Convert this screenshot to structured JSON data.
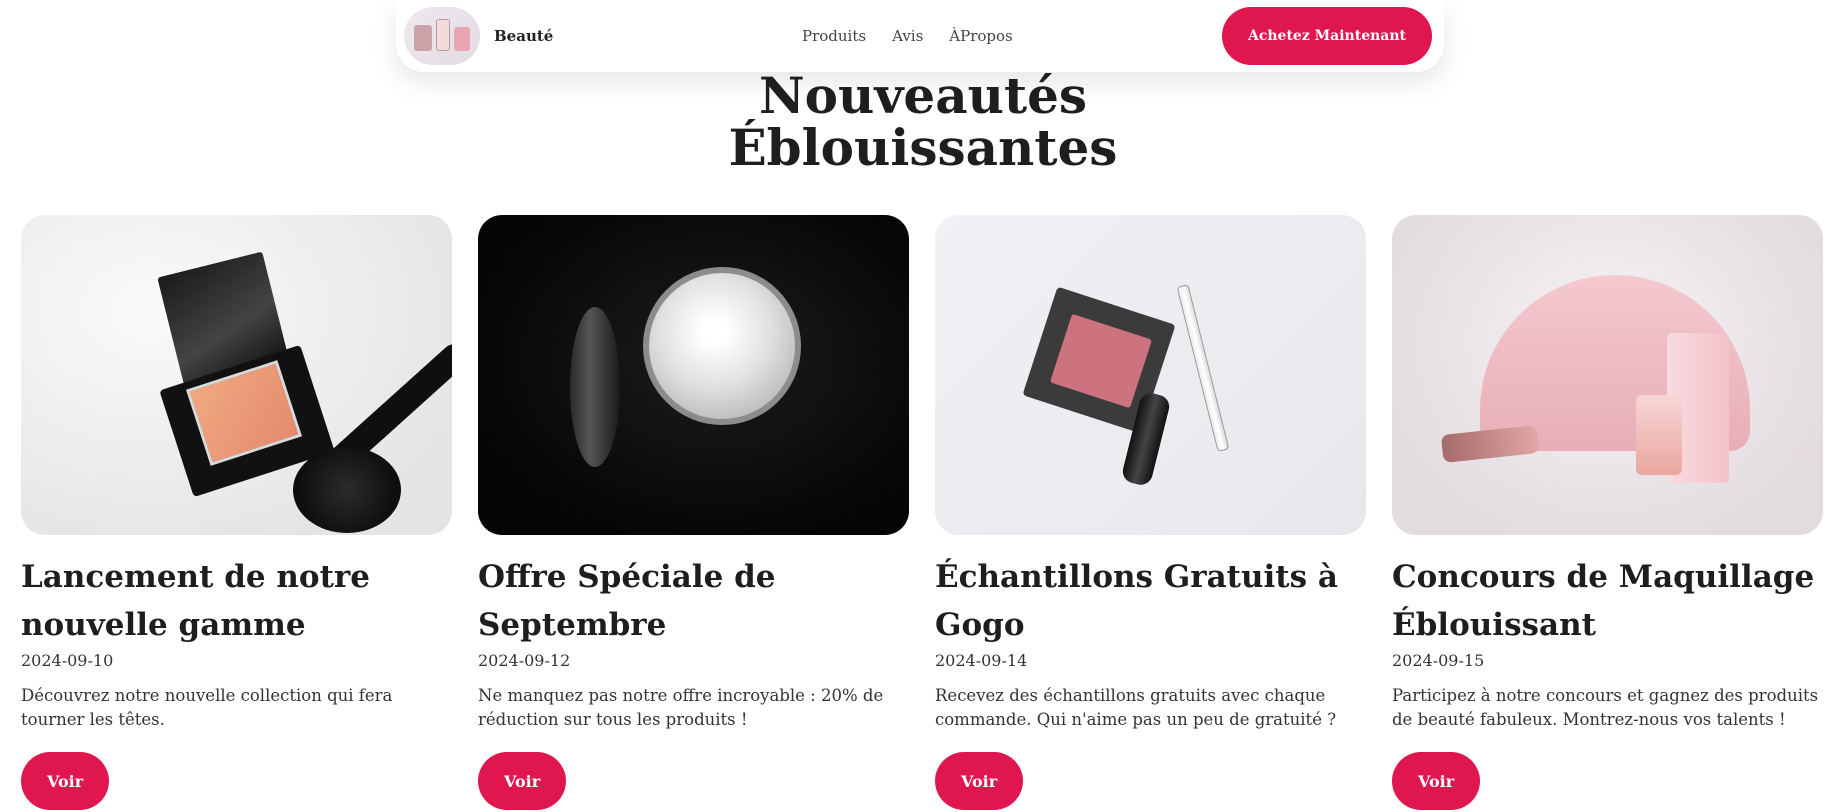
{
  "header": {
    "logo_icon": "cosmetics-logo-image",
    "brand": "Beauté",
    "nav": [
      {
        "label": "Produits"
      },
      {
        "label": "Avis"
      },
      {
        "label": "ÀPropos"
      }
    ],
    "cta_label": "Achetez Maintenant"
  },
  "main": {
    "title_line1": "Nouveautés",
    "title_line2": "Éblouissantes"
  },
  "cards": [
    {
      "title": "Lancement de notre nouvelle gamme",
      "date": "2024-09-10",
      "description": "Découvrez notre nouvelle collection qui fera tourner les têtes.",
      "button": "Voir",
      "image": "makeup-compact-brush"
    },
    {
      "title": "Offre Spéciale de Septembre",
      "date": "2024-09-12",
      "description": "Ne manquez pas notre offre incroyable : 20% de réduction sur tous les produits !",
      "button": "Voir",
      "image": "cotton-jar"
    },
    {
      "title": "Échantillons Gratuits à Gogo",
      "date": "2024-09-14",
      "description": "Recevez des échantillons gratuits avec chaque commande. Qui n'aime pas un peu de gratuité ?",
      "button": "Voir",
      "image": "blush-lipstick-pencil"
    },
    {
      "title": "Concours de Maquillage Éblouissant",
      "date": "2024-09-15",
      "description": "Participez à notre concours et gagnez des produits de beauté fabuleux. Montrez-nous vos talents !",
      "button": "Voir",
      "image": "pink-pouch-cosmetics"
    }
  ],
  "colors": {
    "accent": "#e0174f",
    "text": "#1e1e1e"
  }
}
